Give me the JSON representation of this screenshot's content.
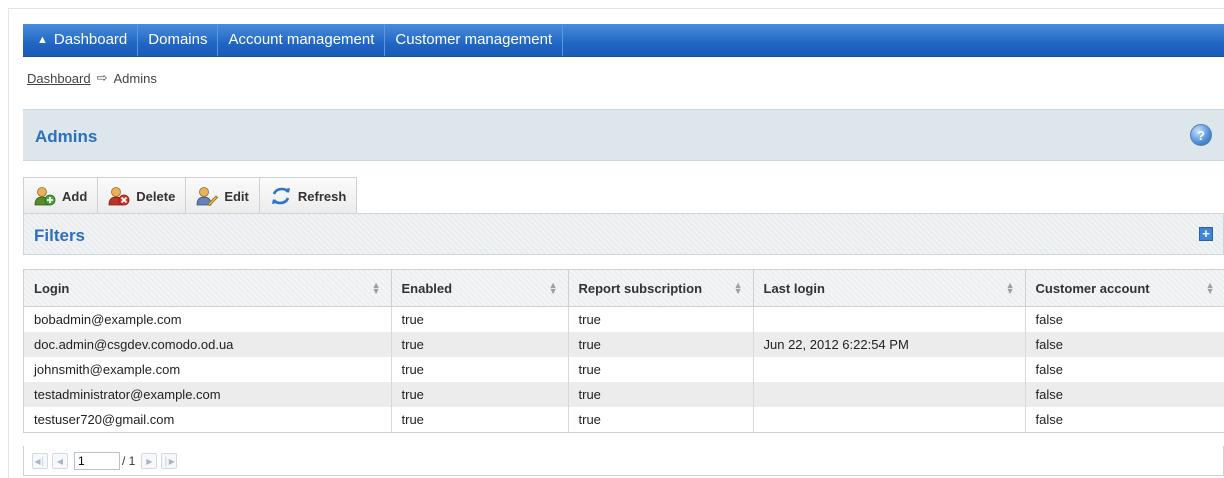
{
  "nav": {
    "items": [
      {
        "label": "Dashboard",
        "icon": "home-icon"
      },
      {
        "label": "Domains"
      },
      {
        "label": "Account management"
      },
      {
        "label": "Customer management"
      }
    ]
  },
  "breadcrumb": {
    "link": "Dashboard",
    "separator_icon": "arrow-right-icon",
    "current": "Admins"
  },
  "panel": {
    "title": "Admins",
    "help_icon": "help-icon"
  },
  "toolbar": {
    "add_label": "Add",
    "delete_label": "Delete",
    "edit_label": "Edit",
    "refresh_label": "Refresh"
  },
  "filters": {
    "title": "Filters",
    "expand_icon": "plus-icon"
  },
  "table": {
    "columns": [
      "Login",
      "Enabled",
      "Report subscription",
      "Last login",
      "Customer account"
    ],
    "rows": [
      [
        "bobadmin@example.com",
        "true",
        "true",
        "",
        "false"
      ],
      [
        "doc.admin@csgdev.comodo.od.ua",
        "true",
        "true",
        "Jun 22, 2012 6:22:54 PM",
        "false"
      ],
      [
        "johnsmith@example.com",
        "true",
        "true",
        "",
        "false"
      ],
      [
        "testadministrator@example.com",
        "true",
        "true",
        "",
        "false"
      ],
      [
        "testuser720@gmail.com",
        "true",
        "true",
        "",
        "false"
      ]
    ]
  },
  "pager": {
    "page": "1",
    "total": "/ 1"
  },
  "colors": {
    "nav_bar": "#2166c4",
    "title_text": "#2b6fbf",
    "panel_bg": "#dde6ea"
  }
}
